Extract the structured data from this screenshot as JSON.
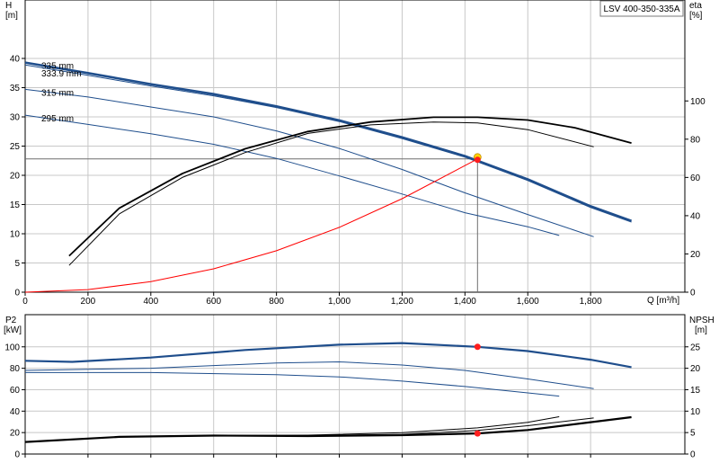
{
  "chart_data": [
    {
      "type": "line",
      "title": "LSV 400-350-335A",
      "left_axis": {
        "label": "H",
        "unit": "[m]",
        "range": [
          0,
          45
        ],
        "ticks": [
          0,
          5,
          10,
          15,
          20,
          25,
          30,
          35,
          40
        ]
      },
      "right_axis": {
        "label": "eta",
        "unit": "[%]",
        "range": [
          0,
          137.5
        ],
        "ticks": [
          0,
          20,
          40,
          60,
          80,
          100
        ]
      },
      "x_axis": {
        "label": "Q [m³/h]",
        "range": [
          0,
          2100
        ],
        "ticks": [
          0,
          200,
          400,
          600,
          800,
          1000,
          1200,
          1400,
          1600,
          1800
        ],
        "tick_labels": [
          "0",
          "200",
          "400",
          "600",
          "800",
          "1,000",
          "1,200",
          "1,400",
          "1,600",
          "1,800"
        ]
      },
      "grid": true,
      "duty_point": {
        "x": 1440,
        "y": 22.8
      },
      "series": [
        {
          "name": "335 mm",
          "kind": "head",
          "color": "#1f4e8c",
          "x": [
            0,
            200,
            400,
            600,
            800,
            1000,
            1200,
            1400,
            1600,
            1800,
            1930
          ],
          "values": [
            39.3,
            37.5,
            35.6,
            33.9,
            31.8,
            29.4,
            26.5,
            23.3,
            19.3,
            14.7,
            12.2
          ]
        },
        {
          "name": "333.9 mm",
          "kind": "head",
          "color": "#1f4e8c",
          "x": [
            0,
            200,
            400,
            600,
            800,
            1000,
            1200,
            1400,
            1600,
            1800,
            1930
          ],
          "values": [
            38.9,
            37.1,
            35.3,
            33.6,
            31.6,
            29.2,
            26.3,
            23.1,
            19.1,
            14.5,
            12.0
          ]
        },
        {
          "name": "315 mm",
          "kind": "head",
          "color": "#1f4e8c",
          "x": [
            0,
            200,
            400,
            600,
            800,
            1000,
            1200,
            1400,
            1600,
            1810
          ],
          "values": [
            34.7,
            33.4,
            31.7,
            30.0,
            27.6,
            24.6,
            21.0,
            17.0,
            13.3,
            9.5
          ]
        },
        {
          "name": "295 mm",
          "kind": "head",
          "color": "#1f4e8c",
          "x": [
            0,
            200,
            400,
            600,
            800,
            1000,
            1200,
            1400,
            1600,
            1700
          ],
          "values": [
            30.3,
            28.7,
            27.1,
            25.3,
            22.9,
            19.9,
            16.8,
            13.6,
            11.2,
            9.7
          ]
        },
        {
          "name": "",
          "kind": "system",
          "color": "#ff0000",
          "x": [
            0,
            200,
            400,
            600,
            800,
            1000,
            1200,
            1440
          ],
          "values": [
            0,
            0.45,
            1.8,
            4.0,
            7.1,
            11.1,
            16.0,
            22.8
          ]
        },
        {
          "name": "",
          "kind": "eta",
          "color": "#000000",
          "x": [
            140,
            300,
            500,
            700,
            900,
            1100,
            1300,
            1440,
            1600,
            1750,
            1930
          ],
          "values": [
            19,
            44,
            62,
            75,
            84,
            89,
            91.5,
            91.5,
            90,
            86,
            78
          ]
        },
        {
          "name": "",
          "kind": "eta",
          "color": "#000000",
          "x": [
            140,
            300,
            500,
            700,
            900,
            1100,
            1300,
            1440,
            1600,
            1810
          ],
          "values": [
            14,
            41,
            60,
            73,
            83,
            87.5,
            89,
            88.5,
            85,
            76
          ]
        }
      ]
    },
    {
      "type": "line",
      "left_axis": {
        "label": "P2",
        "unit": "[kW]",
        "range": [
          0,
          130
        ],
        "ticks": [
          0,
          20,
          40,
          60,
          80,
          100
        ]
      },
      "right_axis": {
        "label": "NPSH",
        "unit": "[m]",
        "range": [
          0,
          32.5
        ],
        "ticks": [
          0,
          5,
          10,
          15,
          20,
          25
        ]
      },
      "x_axis": {
        "range": [
          0,
          2100
        ],
        "ticks": [
          0,
          200,
          400,
          600,
          800,
          1000,
          1200,
          1400,
          1600,
          1800
        ]
      },
      "grid": true,
      "duty_point": {
        "x": 1440,
        "power": 100,
        "npsh": 4.8
      },
      "series": [
        {
          "name": "",
          "kind": "power",
          "color": "#1f4e8c",
          "x": [
            0,
            150,
            400,
            700,
            1000,
            1200,
            1440,
            1600,
            1800,
            1930
          ],
          "values": [
            87,
            86,
            90,
            97,
            102,
            103.5,
            100,
            96,
            88,
            81
          ]
        },
        {
          "name": "",
          "kind": "power",
          "color": "#1f4e8c",
          "x": [
            0,
            400,
            800,
            1000,
            1200,
            1400,
            1600,
            1810
          ],
          "values": [
            78,
            80,
            85,
            86,
            83,
            78,
            70,
            61
          ]
        },
        {
          "name": "",
          "kind": "power",
          "color": "#1f4e8c",
          "x": [
            0,
            400,
            800,
            1000,
            1200,
            1400,
            1600,
            1700
          ],
          "values": [
            76,
            76,
            74,
            72,
            68,
            63,
            57,
            54
          ]
        },
        {
          "name": "",
          "kind": "npsh",
          "color": "#000000",
          "x": [
            0,
            300,
            600,
            900,
            1200,
            1440,
            1600,
            1930
          ],
          "values": [
            2.8,
            4.0,
            4.3,
            4.2,
            4.4,
            4.8,
            5.6,
            8.6
          ]
        },
        {
          "name": "",
          "kind": "npsh",
          "color": "#000000",
          "x": [
            0,
            300,
            600,
            900,
            1200,
            1440,
            1600,
            1810
          ],
          "values": [
            2.8,
            4.0,
            4.3,
            4.3,
            4.6,
            5.5,
            6.6,
            8.4
          ]
        },
        {
          "name": "",
          "kind": "npsh",
          "color": "#000000",
          "x": [
            0,
            300,
            600,
            900,
            1200,
            1440,
            1600,
            1700
          ],
          "values": [
            2.8,
            4.0,
            4.3,
            4.4,
            5.0,
            6.1,
            7.4,
            8.7
          ]
        }
      ]
    }
  ]
}
